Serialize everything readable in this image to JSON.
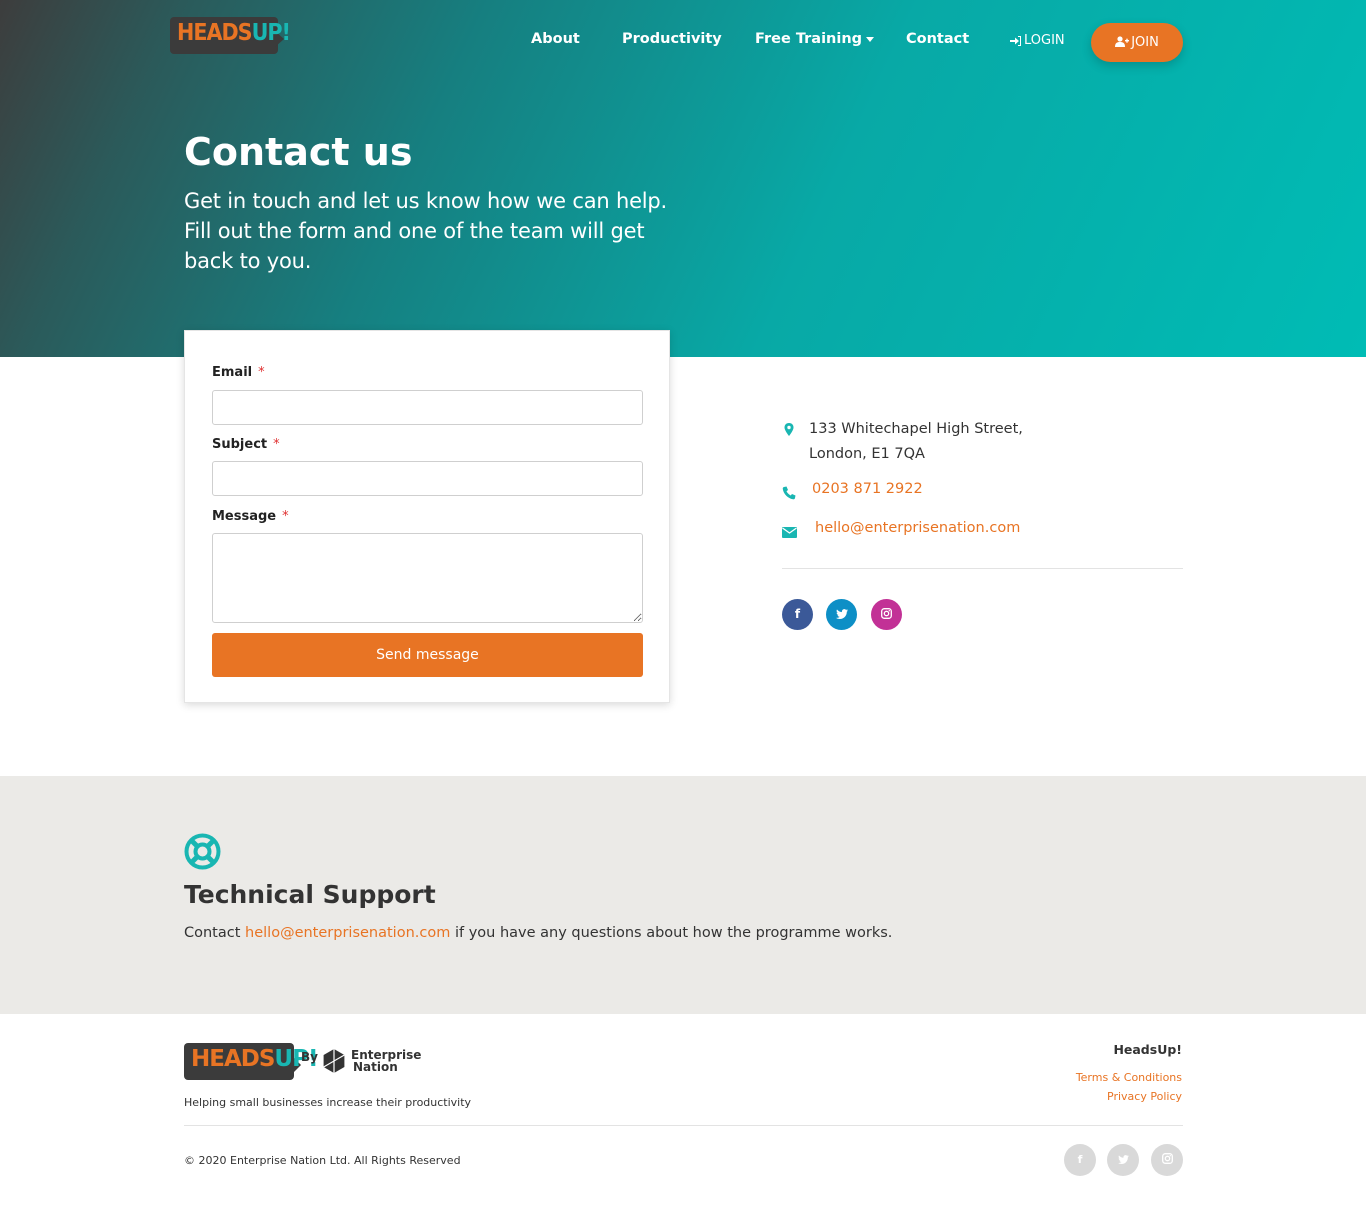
{
  "header": {
    "logo": {
      "heads": "HEADS",
      "up": "UP!"
    },
    "nav": {
      "about": "About",
      "productivity": "Productivity",
      "free_training": "Free Training",
      "contact": "Contact",
      "login": "LOGIN",
      "join": "JOIN"
    }
  },
  "hero": {
    "title": "Contact us",
    "subtitle": "Get in touch and let us know how we can help. Fill out the form and one of the team will get back to you."
  },
  "form": {
    "email_label": "Email",
    "subject_label": "Subject",
    "message_label": "Message",
    "required_mark": "*",
    "email_value": "",
    "subject_value": "",
    "message_value": "",
    "submit_label": "Send message"
  },
  "contact_info": {
    "address_line1": "133 Whitechapel High Street,",
    "address_line2": "London, E1 7QA",
    "phone": "0203 871 2922",
    "email": "hello@enterprisenation.com"
  },
  "support": {
    "title": "Technical Support",
    "text_before": "Contact ",
    "email": "hello@enterprisenation.com",
    "text_after": " if you have any questions about how the programme works."
  },
  "footer": {
    "logo": {
      "heads": "HEADS",
      "up": "UP!",
      "by": "By",
      "partner_line1": "Enterprise",
      "partner_line2": "Nation"
    },
    "tagline": "Helping small businesses increase their productivity",
    "right_title": "HeadsUp!",
    "links": {
      "terms": "Terms & Conditions",
      "privacy": "Privacy Policy"
    },
    "copyright": "© 2020 Enterprise Nation Ltd. All Rights Reserved"
  },
  "colors": {
    "accent": "#e87424",
    "teal": "#00bcb5",
    "facebook": "#3b5998",
    "twitter": "#0d8fc6",
    "instagram": "#c23196"
  },
  "icons": {
    "social": [
      "facebook-icon",
      "twitter-icon",
      "instagram-icon"
    ],
    "contact": [
      "map-marker-icon",
      "phone-icon",
      "envelope-icon"
    ],
    "support": "lifebuoy-icon"
  }
}
